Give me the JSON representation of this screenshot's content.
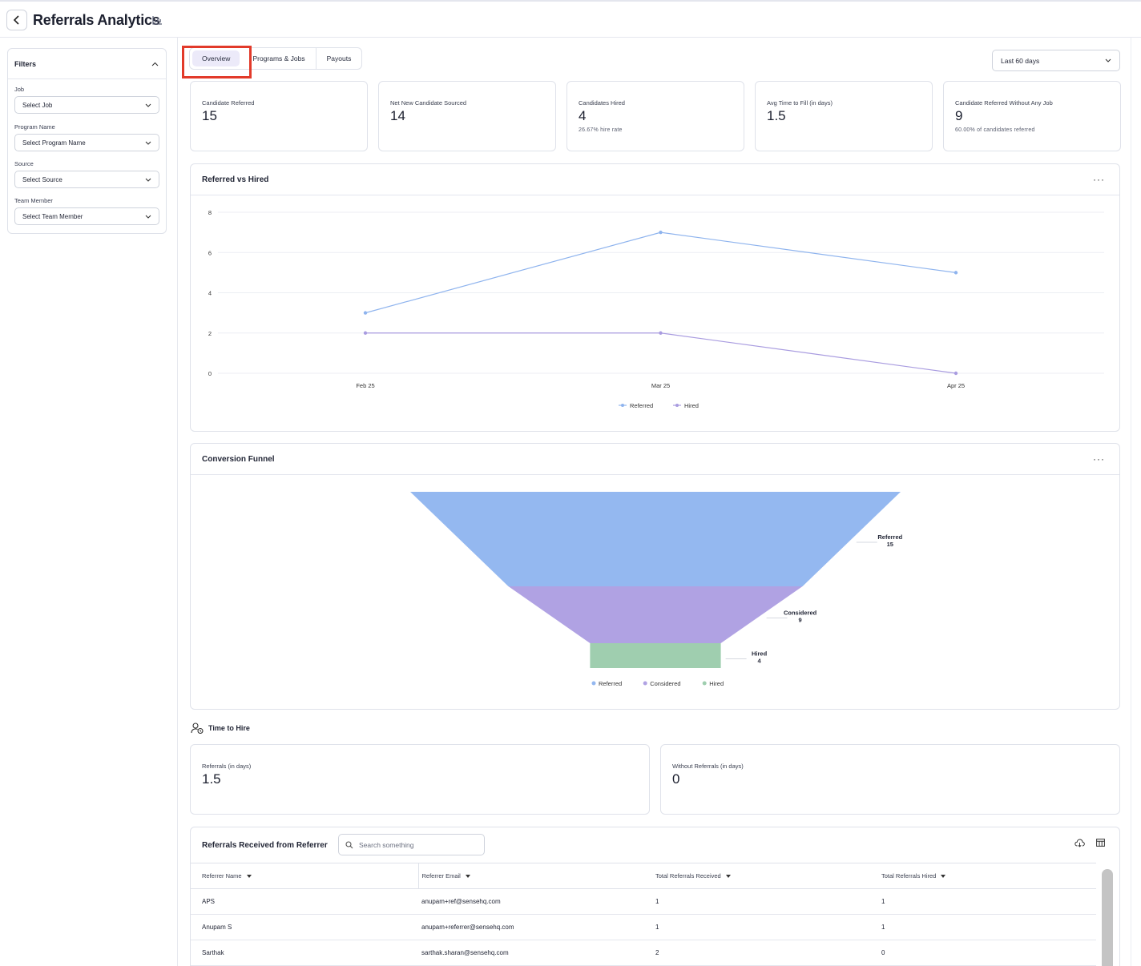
{
  "header": {
    "title": "Referrals Analytics",
    "back_icon": "chevron-left-icon",
    "title_icon": "bar-chart-icon"
  },
  "filters": {
    "title": "Filters",
    "fields": [
      {
        "label": "Job",
        "placeholder": "Select Job"
      },
      {
        "label": "Program Name",
        "placeholder": "Select Program Name"
      },
      {
        "label": "Source",
        "placeholder": "Select Source"
      },
      {
        "label": "Team Member",
        "placeholder": "Select Team Member"
      }
    ]
  },
  "tabs": [
    {
      "label": "Overview",
      "active": true
    },
    {
      "label": "Programs & Jobs",
      "active": false
    },
    {
      "label": "Payouts",
      "active": false
    }
  ],
  "date_range": "Last 60 days",
  "kpis": [
    {
      "label": "Candidate Referred",
      "value": "15",
      "sub": ""
    },
    {
      "label": "Net New Candidate Sourced",
      "value": "14",
      "sub": ""
    },
    {
      "label": "Candidates Hired",
      "value": "4",
      "sub": "26.67% hire rate"
    },
    {
      "label": "Avg Time to Fill (in days)",
      "value": "1.5",
      "sub": ""
    },
    {
      "label": "Candidate Referred Without Any Job",
      "value": "9",
      "sub": "60.00% of candidates referred"
    }
  ],
  "referred_vs_hired": {
    "title": "Referred vs Hired",
    "more": "···"
  },
  "funnel": {
    "title": "Conversion Funnel",
    "more": "···"
  },
  "chart_data": [
    {
      "type": "line",
      "title": "Referred vs Hired",
      "categories": [
        "Feb 25",
        "Mar 25",
        "Apr 25"
      ],
      "series": [
        {
          "name": "Referred",
          "values": [
            3,
            7,
            5
          ],
          "color": "#8fb4ee"
        },
        {
          "name": "Hired",
          "values": [
            2,
            2,
            0
          ],
          "color": "#a99ce0"
        }
      ],
      "ylim": [
        0,
        8
      ],
      "yticks": [
        "0",
        "2",
        "4",
        "6",
        "8"
      ],
      "grid": true,
      "legend": "bottom"
    },
    {
      "type": "funnel",
      "title": "Conversion Funnel",
      "stages": [
        {
          "name": "Referred",
          "value": 15,
          "color": "#94b8f0"
        },
        {
          "name": "Considered",
          "value": 9,
          "color": "#b0a2e3"
        },
        {
          "name": "Hired",
          "value": 4,
          "color": "#9fceaf"
        }
      ],
      "legend": "bottom"
    }
  ],
  "time_to_hire": {
    "title": "Time to Hire",
    "icon": "user-clock-icon",
    "cards": [
      {
        "label": "Referrals (in days)",
        "value": "1.5"
      },
      {
        "label": "Without Referrals (in days)",
        "value": "0"
      }
    ]
  },
  "referrer_table": {
    "title": "Referrals Received from Referrer",
    "search_placeholder": "Search something",
    "columns": [
      "Referrer Name",
      "Referrer Email",
      "Total Referrals Received",
      "Total Referrals Hired"
    ],
    "rows": [
      [
        "APS",
        "anupam+ref@sensehq.com",
        "1",
        "1"
      ],
      [
        "Anupam S",
        "anupam+referrer@sensehq.com",
        "1",
        "1"
      ],
      [
        "Sarthak",
        "sarthak.sharan@sensehq.com",
        "2",
        "0"
      ]
    ]
  }
}
